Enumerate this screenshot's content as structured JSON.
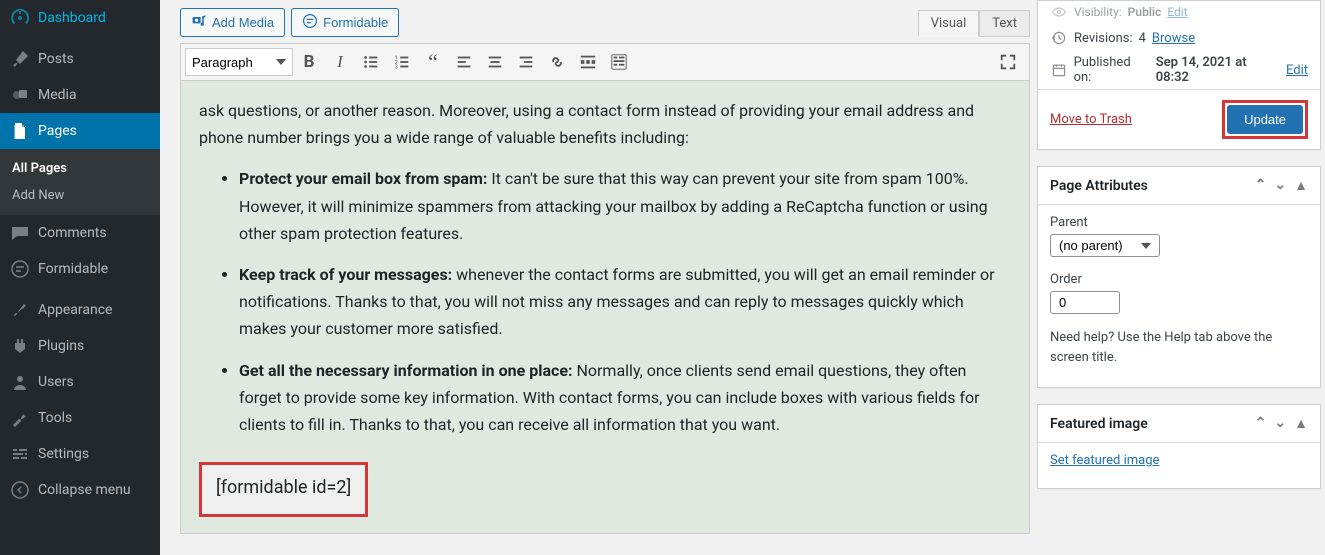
{
  "sidebar": {
    "items": [
      {
        "label": "Dashboard"
      },
      {
        "label": "Posts"
      },
      {
        "label": "Media"
      },
      {
        "label": "Pages"
      },
      {
        "label": "Comments"
      },
      {
        "label": "Formidable"
      },
      {
        "label": "Appearance"
      },
      {
        "label": "Plugins"
      },
      {
        "label": "Users"
      },
      {
        "label": "Tools"
      },
      {
        "label": "Settings"
      },
      {
        "label": "Collapse menu"
      }
    ],
    "submenu": [
      {
        "label": "All Pages"
      },
      {
        "label": "Add New"
      }
    ]
  },
  "editor": {
    "add_media": "Add Media",
    "formidable_btn": "Formidable",
    "tabs": {
      "visual": "Visual",
      "text": "Text"
    },
    "format_select": "Paragraph",
    "intro": "ask questions, or another reason. Moreover, using a contact form instead of providing your email address and phone number brings you a wide range of valuable benefits including:",
    "bullets": [
      {
        "bold": "Protect your email box from spam:",
        "text": " It can't be sure that this way can prevent your site from spam 100%. However, it will minimize spammers from attacking your mailbox by adding a ReCaptcha function or using other spam protection features."
      },
      {
        "bold": "Keep track of your messages:",
        "text": " whenever the contact forms are submitted, you will get an email reminder or notifications. Thanks to that, you will not miss any messages and can reply to messages quickly which makes your customer more satisfied."
      },
      {
        "bold": "Get all the necessary information in one place:",
        "text": " Normally, once clients send email questions, they often forget to provide some key information. With contact forms, you can include boxes with various fields for clients to fill in. Thanks to that, you can receive all information that you want."
      }
    ],
    "shortcode": "[formidable id=2]"
  },
  "publish": {
    "visibility_label": "Visibility:",
    "visibility_value": "Public",
    "edit": "Edit",
    "revisions_label": "Revisions:",
    "revisions_count": "4",
    "browse": "Browse",
    "published_label": "Published on:",
    "published_value": "Sep 14, 2021 at 08:32",
    "trash": "Move to Trash",
    "update": "Update"
  },
  "attributes": {
    "title": "Page Attributes",
    "parent_label": "Parent",
    "parent_value": "(no parent)",
    "order_label": "Order",
    "order_value": "0",
    "help": "Need help? Use the Help tab above the screen title."
  },
  "featured": {
    "title": "Featured image",
    "link": "Set featured image"
  }
}
